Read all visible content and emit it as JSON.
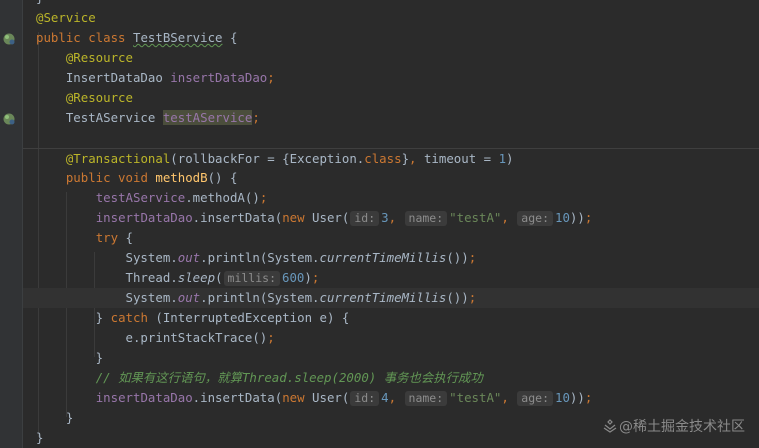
{
  "code_lines": [
    {
      "id": "l1",
      "tokens": [
        {
          "c": "ann",
          "t": "@Service"
        }
      ]
    },
    {
      "id": "l2",
      "tokens": [
        {
          "c": "kw",
          "t": "public class "
        },
        {
          "c": "plain underline",
          "t": "TestBService"
        },
        {
          "c": "plain",
          "t": " {"
        }
      ]
    },
    {
      "id": "l3",
      "tokens": [
        {
          "c": "plain",
          "t": "    "
        },
        {
          "c": "ann",
          "t": "@Resource"
        }
      ]
    },
    {
      "id": "l4",
      "tokens": [
        {
          "c": "plain",
          "t": "    InsertDataDao "
        },
        {
          "c": "field",
          "t": "insertDataDao"
        },
        {
          "c": "kw",
          "t": ";"
        }
      ]
    },
    {
      "id": "l5",
      "tokens": [
        {
          "c": "plain",
          "t": "    "
        },
        {
          "c": "ann",
          "t": "@Resource"
        }
      ]
    },
    {
      "id": "l6",
      "tokens": [
        {
          "c": "plain",
          "t": "    TestAService "
        },
        {
          "c": "field sel",
          "t": "testAService"
        },
        {
          "c": "kw",
          "t": ";"
        }
      ]
    },
    {
      "id": "l7",
      "tokens": []
    },
    {
      "id": "l8",
      "tokens": [
        {
          "c": "plain",
          "t": "    "
        },
        {
          "c": "ann",
          "t": "@Transactional"
        },
        {
          "c": "plain",
          "t": "(rollbackFor = {Exception."
        },
        {
          "c": "kw",
          "t": "class"
        },
        {
          "c": "plain",
          "t": "}"
        },
        {
          "c": "kw",
          "t": ", "
        },
        {
          "c": "plain",
          "t": "timeout = "
        },
        {
          "c": "num",
          "t": "1"
        },
        {
          "c": "plain",
          "t": ")"
        }
      ]
    },
    {
      "id": "l9",
      "tokens": [
        {
          "c": "plain",
          "t": "    "
        },
        {
          "c": "kw",
          "t": "public void "
        },
        {
          "c": "fn",
          "t": "methodB"
        },
        {
          "c": "plain",
          "t": "() {"
        }
      ]
    },
    {
      "id": "l10",
      "tokens": [
        {
          "c": "plain",
          "t": "        "
        },
        {
          "c": "field",
          "t": "testAService"
        },
        {
          "c": "plain",
          "t": ".methodA()"
        },
        {
          "c": "kw",
          "t": ";"
        }
      ]
    },
    {
      "id": "l11",
      "tokens": [
        {
          "c": "plain",
          "t": "        "
        },
        {
          "c": "field",
          "t": "insertDataDao"
        },
        {
          "c": "plain",
          "t": ".insertData("
        },
        {
          "c": "kw",
          "t": "new "
        },
        {
          "c": "plain",
          "t": "User("
        },
        {
          "c": "hint",
          "t": "id:"
        },
        {
          "c": "num",
          "t": "3"
        },
        {
          "c": "kw",
          "t": ", "
        },
        {
          "c": "hint",
          "t": "name:"
        },
        {
          "c": "str",
          "t": "\"testA\""
        },
        {
          "c": "kw",
          "t": ", "
        },
        {
          "c": "hint",
          "t": "age:"
        },
        {
          "c": "num",
          "t": "10"
        },
        {
          "c": "plain",
          "t": "))"
        },
        {
          "c": "kw",
          "t": ";"
        }
      ]
    },
    {
      "id": "l12",
      "tokens": [
        {
          "c": "plain",
          "t": "        "
        },
        {
          "c": "kw",
          "t": "try "
        },
        {
          "c": "plain",
          "t": "{"
        }
      ]
    },
    {
      "id": "l13",
      "tokens": [
        {
          "c": "plain",
          "t": "            System."
        },
        {
          "c": "sfield",
          "t": "out"
        },
        {
          "c": "plain",
          "t": ".println(System."
        },
        {
          "c": "static",
          "t": "currentTimeMillis"
        },
        {
          "c": "plain",
          "t": "())"
        },
        {
          "c": "kw",
          "t": ";"
        }
      ]
    },
    {
      "id": "l14",
      "tokens": [
        {
          "c": "plain",
          "t": "            Thread."
        },
        {
          "c": "static",
          "t": "sleep"
        },
        {
          "c": "plain",
          "t": "("
        },
        {
          "c": "hint",
          "t": "millis:"
        },
        {
          "c": "num",
          "t": "600"
        },
        {
          "c": "plain",
          "t": ")"
        },
        {
          "c": "kw",
          "t": ";"
        }
      ]
    },
    {
      "id": "l15",
      "tokens": [
        {
          "c": "plain",
          "t": "            System."
        },
        {
          "c": "sfield",
          "t": "out"
        },
        {
          "c": "plain",
          "t": ".println(System."
        },
        {
          "c": "static",
          "t": "currentTimeMillis"
        },
        {
          "c": "plain",
          "t": "())"
        },
        {
          "c": "kw",
          "t": ";"
        }
      ]
    },
    {
      "id": "l16",
      "tokens": [
        {
          "c": "plain",
          "t": "        } "
        },
        {
          "c": "kw",
          "t": "catch "
        },
        {
          "c": "plain",
          "t": "(InterruptedException e) {"
        }
      ]
    },
    {
      "id": "l17",
      "tokens": [
        {
          "c": "plain",
          "t": "            e.printStackTrace()"
        },
        {
          "c": "kw",
          "t": ";"
        }
      ]
    },
    {
      "id": "l18",
      "tokens": [
        {
          "c": "plain",
          "t": "        }"
        }
      ]
    },
    {
      "id": "l19",
      "tokens": [
        {
          "c": "plain",
          "t": "        "
        },
        {
          "c": "cmt",
          "t": "// 如果有这行语句，就算Thread.sleep(2000) 事务也会执行成功"
        }
      ]
    },
    {
      "id": "l20",
      "tokens": [
        {
          "c": "plain",
          "t": "        "
        },
        {
          "c": "field",
          "t": "insertDataDao"
        },
        {
          "c": "plain",
          "t": ".insertData("
        },
        {
          "c": "kw",
          "t": "new "
        },
        {
          "c": "plain",
          "t": "User("
        },
        {
          "c": "hint",
          "t": "id:"
        },
        {
          "c": "num",
          "t": "4"
        },
        {
          "c": "kw",
          "t": ", "
        },
        {
          "c": "hint",
          "t": "name:"
        },
        {
          "c": "str",
          "t": "\"testA\""
        },
        {
          "c": "kw",
          "t": ", "
        },
        {
          "c": "hint",
          "t": "age:"
        },
        {
          "c": "num",
          "t": "10"
        },
        {
          "c": "plain",
          "t": "))"
        },
        {
          "c": "kw",
          "t": ";"
        }
      ]
    },
    {
      "id": "l21",
      "tokens": [
        {
          "c": "plain",
          "t": "    }"
        }
      ]
    },
    {
      "id": "l22",
      "tokens": [
        {
          "c": "plain",
          "t": "}"
        }
      ]
    }
  ],
  "top_partial": "}",
  "watermark": "@稀土掘金技术社区",
  "colors": {
    "background": "#2b2b2b",
    "gutter": "#313335",
    "keyword": "#cc7832",
    "annotation": "#bbb529",
    "string": "#6a8759",
    "number": "#6897bb",
    "field": "#9876aa",
    "method": "#ffc66d",
    "comment": "#629755"
  },
  "gutter_icons": [
    "spring-bean-icon",
    "spring-bean-icon"
  ]
}
